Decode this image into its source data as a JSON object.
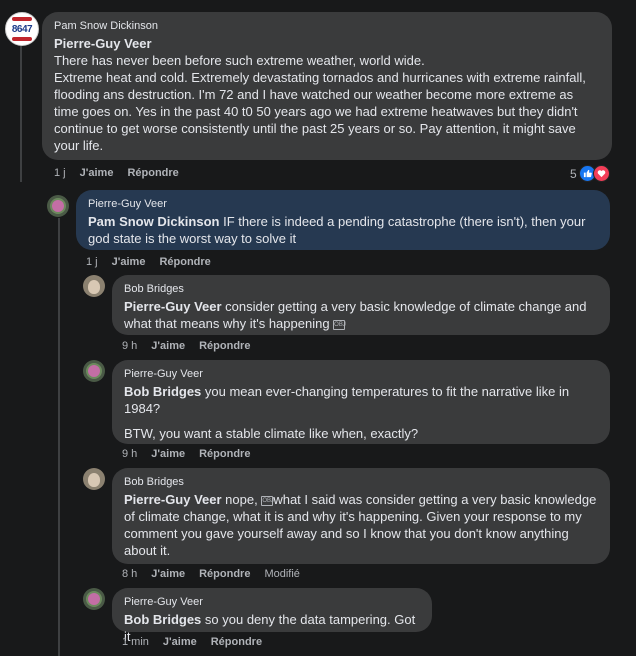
{
  "comments": [
    {
      "author": "Pam Snow Dickinson",
      "mention": "Pierre-Guy Veer",
      "text1": "There has never been before such extreme weather, world wide.",
      "text2": "Extreme heat and cold. Extremely devastating tornados and hurricanes with extreme rainfall, flooding ans destruction. I'm 72 and I have watched our weather become more extreme as time goes on. Yes in the past 40 t0 50 years ago we had extreme heatwaves but they didn't continue to get worse consistently until the past 25 years or so. Pay attention, it might save your life.",
      "time": "1 j",
      "like": "J'aime",
      "reply": "Répondre",
      "reaction_count": "5"
    },
    {
      "author": "Pierre-Guy Veer",
      "mention": "Pam Snow Dickinson",
      "text": " IF there is indeed a pending catastrophe (there isn't), then your god state is the worst way to solve it",
      "time": "1 j",
      "like": "J'aime",
      "reply": "Répondre"
    },
    {
      "author": "Bob Bridges",
      "mention": "Pierre-Guy Veer",
      "text": " consider getting a very basic knowledge of climate change and what that means why it's happening ",
      "time": "9 h",
      "like": "J'aime",
      "reply": "Répondre"
    },
    {
      "author": "Pierre-Guy Veer",
      "mention": "Bob Bridges",
      "text": " you mean ever-changing temperatures to fit the narrative like in 1984?",
      "text2": "BTW, you want a stable climate like when, exactly?",
      "time": "9 h",
      "like": "J'aime",
      "reply": "Répondre"
    },
    {
      "author": "Bob Bridges",
      "mention": "Pierre-Guy Veer",
      "text_a": " nope, ",
      "text_b": "what I said was consider getting a very basic knowledge of climate change, what it is and why it's happening. Given your response to my comment you gave yourself away and so I know that you don't know anything about it.",
      "time": "8 h",
      "like": "J'aime",
      "reply": "Répondre",
      "modified": "Modifié"
    },
    {
      "author": "Pierre-Guy Veer",
      "mention": "Bob Bridges",
      "text": " so you deny the data tampering. Got it",
      "time": "1 min",
      "like": "J'aime",
      "reply": "Répondre"
    }
  ],
  "avatar_badge": "8647",
  "glyph_text": "OBJ",
  "colors": {
    "background": "#18191a",
    "bubble": "#3a3b3c",
    "highlight_bubble": "#263951",
    "like": "#1877f2",
    "love": "#f33e58"
  },
  "icons": {
    "like": "thumbs-up-icon",
    "love": "heart-icon"
  }
}
